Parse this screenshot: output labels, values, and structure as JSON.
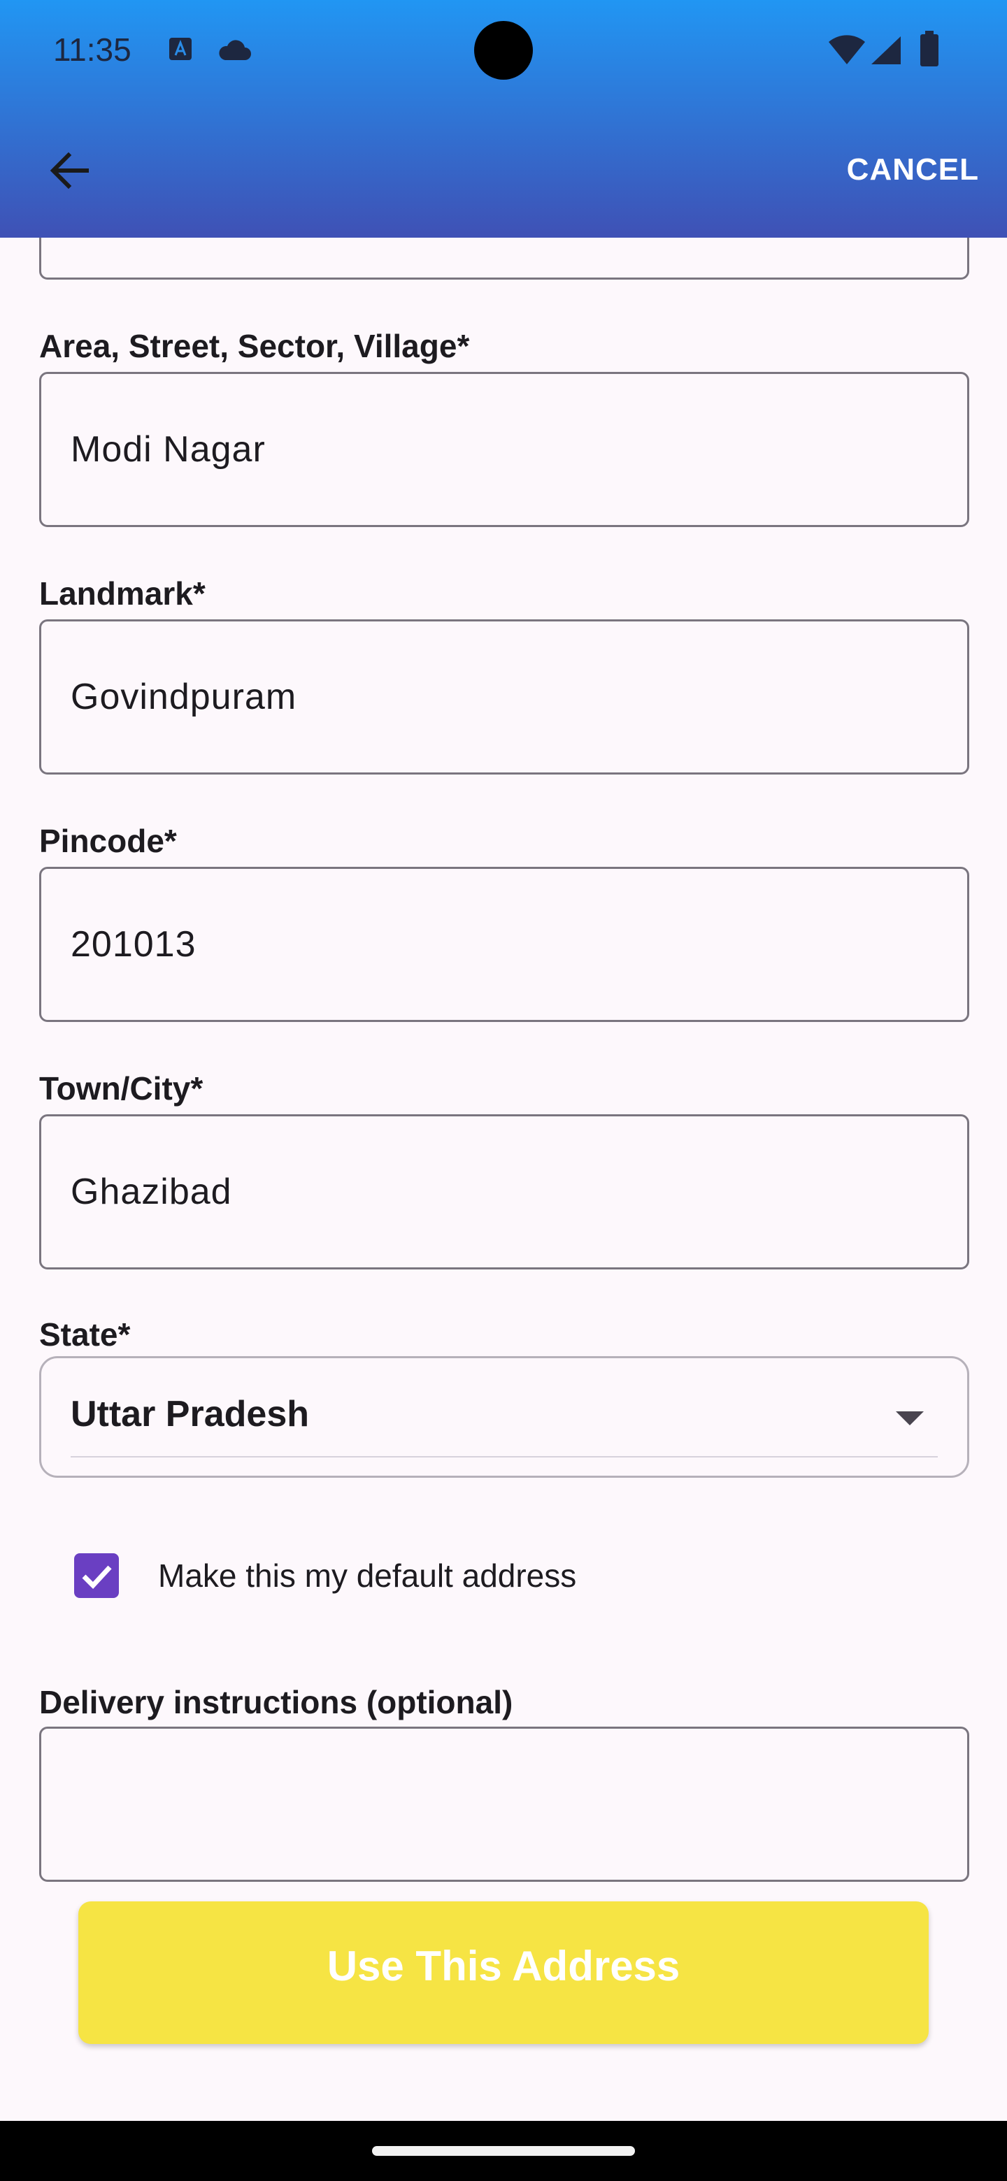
{
  "status_bar": {
    "time": "11:35"
  },
  "app_bar": {
    "cancel_label": "CANCEL"
  },
  "form": {
    "area": {
      "label": "Area, Street, Sector, Village*",
      "value": "Modi Nagar"
    },
    "landmark": {
      "label": "Landmark*",
      "value": "Govindpuram"
    },
    "pincode": {
      "label": "Pincode*",
      "value": "201013"
    },
    "city": {
      "label": "Town/City*",
      "value": "Ghazibad"
    },
    "state": {
      "label": "State*",
      "value": "Uttar Pradesh"
    },
    "default_address": {
      "label": "Make this my default address",
      "checked": true
    },
    "delivery": {
      "label": "Delivery instructions (optional)",
      "value": ""
    }
  },
  "submit": {
    "label": "Use This Address"
  },
  "colors": {
    "accent": "#3f51b5",
    "button": "#f6e444",
    "checkbox": "#6a3fc2"
  }
}
